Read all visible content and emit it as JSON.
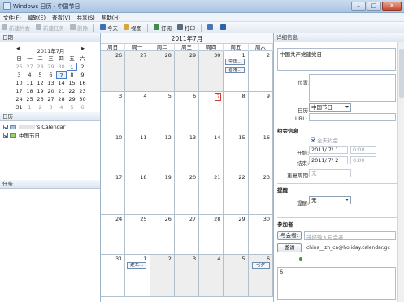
{
  "window": {
    "title": "Windows 日历 - 中国节日",
    "minimize": "–",
    "maximize": "□",
    "close": "✕"
  },
  "menu": [
    "文件(F)",
    "编辑(E)",
    "查看(V)",
    "共享(S)",
    "帮助(H)"
  ],
  "toolbar": [
    {
      "label": "新建约会",
      "enabled": false,
      "icon": "appointment-icon",
      "color": "#b0b7bf"
    },
    {
      "label": "新建任务",
      "enabled": false,
      "icon": "task-icon",
      "color": "#b0b7bf"
    },
    {
      "label": "删除",
      "enabled": false,
      "icon": "delete-icon",
      "color": "#b0b7bf"
    },
    {
      "label": "今天",
      "enabled": true,
      "icon": "today-icon",
      "color": "#3c6fb3"
    },
    {
      "label": "视图",
      "enabled": true,
      "icon": "view-icon",
      "color": "#e0a23b"
    },
    {
      "label": "订阅",
      "enabled": true,
      "icon": "subscribe-icon",
      "color": "#3d8c4b"
    },
    {
      "label": "打印",
      "enabled": true,
      "icon": "print-icon",
      "color": "#5a6b7d"
    },
    {
      "label": "",
      "enabled": true,
      "icon": "email-icon",
      "color": "#4a78b5"
    },
    {
      "label": "",
      "enabled": true,
      "icon": "help-icon",
      "color": "#2e63a8"
    }
  ],
  "left": {
    "date_header": "日期",
    "mini_month": "2011年7月",
    "prev": "◀",
    "next": "▶",
    "dow": [
      "日",
      "一",
      "二",
      "三",
      "四",
      "五",
      "六"
    ],
    "days": [
      [
        "26",
        "27",
        "28",
        "29",
        "30",
        "1",
        "2"
      ],
      [
        "3",
        "4",
        "5",
        "6",
        "7",
        "8",
        "9"
      ],
      [
        "10",
        "11",
        "12",
        "13",
        "14",
        "15",
        "16"
      ],
      [
        "17",
        "18",
        "19",
        "20",
        "21",
        "22",
        "23"
      ],
      [
        "24",
        "25",
        "26",
        "27",
        "28",
        "29",
        "30"
      ],
      [
        "31",
        "1",
        "2",
        "3",
        "4",
        "5",
        "6"
      ]
    ],
    "calendar_header": "日历",
    "calendars": [
      {
        "label": "'s Calendar",
        "color": "#a2c0e6"
      },
      {
        "label": "中国节日",
        "color": "#9bd06d"
      }
    ],
    "task_header": "任务"
  },
  "main": {
    "title": "2011年7月",
    "dow": [
      "周日",
      "周一",
      "周二",
      "周三",
      "周四",
      "周五",
      "周六"
    ],
    "days": [
      "26",
      "27",
      "28",
      "29",
      "30",
      "1",
      "2",
      "3",
      "4",
      "5",
      "6",
      "7",
      "8",
      "9",
      "10",
      "11",
      "12",
      "13",
      "14",
      "15",
      "16",
      "17",
      "18",
      "19",
      "20",
      "21",
      "22",
      "23",
      "24",
      "25",
      "26",
      "27",
      "28",
      "29",
      "30",
      "31",
      "1",
      "2",
      "3",
      "4",
      "5",
      "6"
    ],
    "events": [
      {
        "cell": 5,
        "row": 0,
        "text": "中国..."
      },
      {
        "cell": 5,
        "row": 1,
        "text": "香港..."
      },
      {
        "cell": 36,
        "row": 0,
        "text": "建军..."
      },
      {
        "cell": 41,
        "row": 0,
        "text": "七夕"
      }
    ]
  },
  "details": {
    "header": "详细信息",
    "title_value": "中国共产党建党日",
    "location_label": "位置:",
    "calendar_label": "日历:",
    "calendar_value": "中国节日",
    "url_label": "URL:",
    "appointment_section": "约会信息",
    "all_day_label": "全天约会",
    "start_label": "开始:",
    "start_date": "2011/ 7/ 1",
    "start_time": "0:00",
    "end_label": "结束:",
    "end_date": "2011/ 7/ 2",
    "end_time": "0:00",
    "recurrence_label": "重复周期:",
    "recurrence_value": "无",
    "reminder_section": "提醒",
    "reminder_label": "提醒:",
    "reminder_value": "无",
    "participants_section": "参加者",
    "participants_button": "与会者:",
    "participants_placeholder": "选择输入与会者",
    "invite_button": "邀请",
    "participant_email": "china__zh_cn@holiday.calendar.gc",
    "notes_value": "6"
  }
}
